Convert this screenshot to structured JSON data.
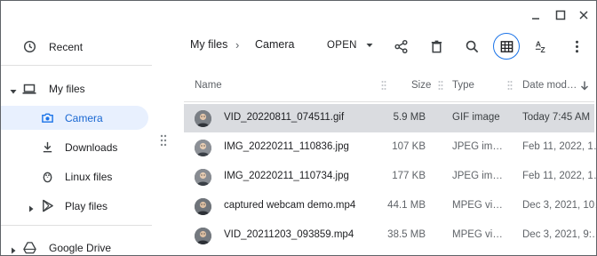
{
  "window": {
    "controls": [
      "minimize-icon",
      "maximize-icon",
      "close-icon"
    ]
  },
  "sidebar": {
    "items": [
      {
        "label": "Recent",
        "icon": "clock-icon"
      },
      {
        "label": "My files",
        "icon": "laptop-icon"
      },
      {
        "label": "Camera",
        "icon": "camera-icon"
      },
      {
        "label": "Downloads",
        "icon": "download-icon"
      },
      {
        "label": "Linux files",
        "icon": "penguin-icon"
      },
      {
        "label": "Play files",
        "icon": "play-icon"
      },
      {
        "label": "Google Drive",
        "icon": "drive-icon"
      }
    ]
  },
  "breadcrumb": {
    "parent": "My files",
    "separator": "›",
    "current": "Camera"
  },
  "toolbar": {
    "open_label": "OPEN",
    "icons": [
      "share-icon",
      "delete-icon",
      "search-icon",
      "grid-view-icon",
      "sort-icon",
      "more-icon"
    ],
    "accent": "#1a73e8"
  },
  "columns": {
    "name": "Name",
    "size": "Size",
    "type": "Type",
    "date": "Date mod…"
  },
  "files": [
    {
      "name": "VID_20220811_074511.gif",
      "size": "5.9 MB",
      "type": "GIF image",
      "date": "Today 7:45 AM",
      "selected": true
    },
    {
      "name": "IMG_20220211_110836.jpg",
      "size": "107 KB",
      "type": "JPEG im…",
      "date": "Feb 11, 2022, 1…",
      "selected": false
    },
    {
      "name": "IMG_20220211_110734.jpg",
      "size": "177 KB",
      "type": "JPEG im…",
      "date": "Feb 11, 2022, 1…",
      "selected": false
    },
    {
      "name": "captured webcam demo.mp4",
      "size": "44.1 MB",
      "type": "MPEG vi…",
      "date": "Dec 3, 2021, 10…",
      "selected": false
    },
    {
      "name": "VID_20211203_093859.mp4",
      "size": "38.5 MB",
      "type": "MPEG vi…",
      "date": "Dec 3, 2021, 9:…",
      "selected": false
    }
  ]
}
